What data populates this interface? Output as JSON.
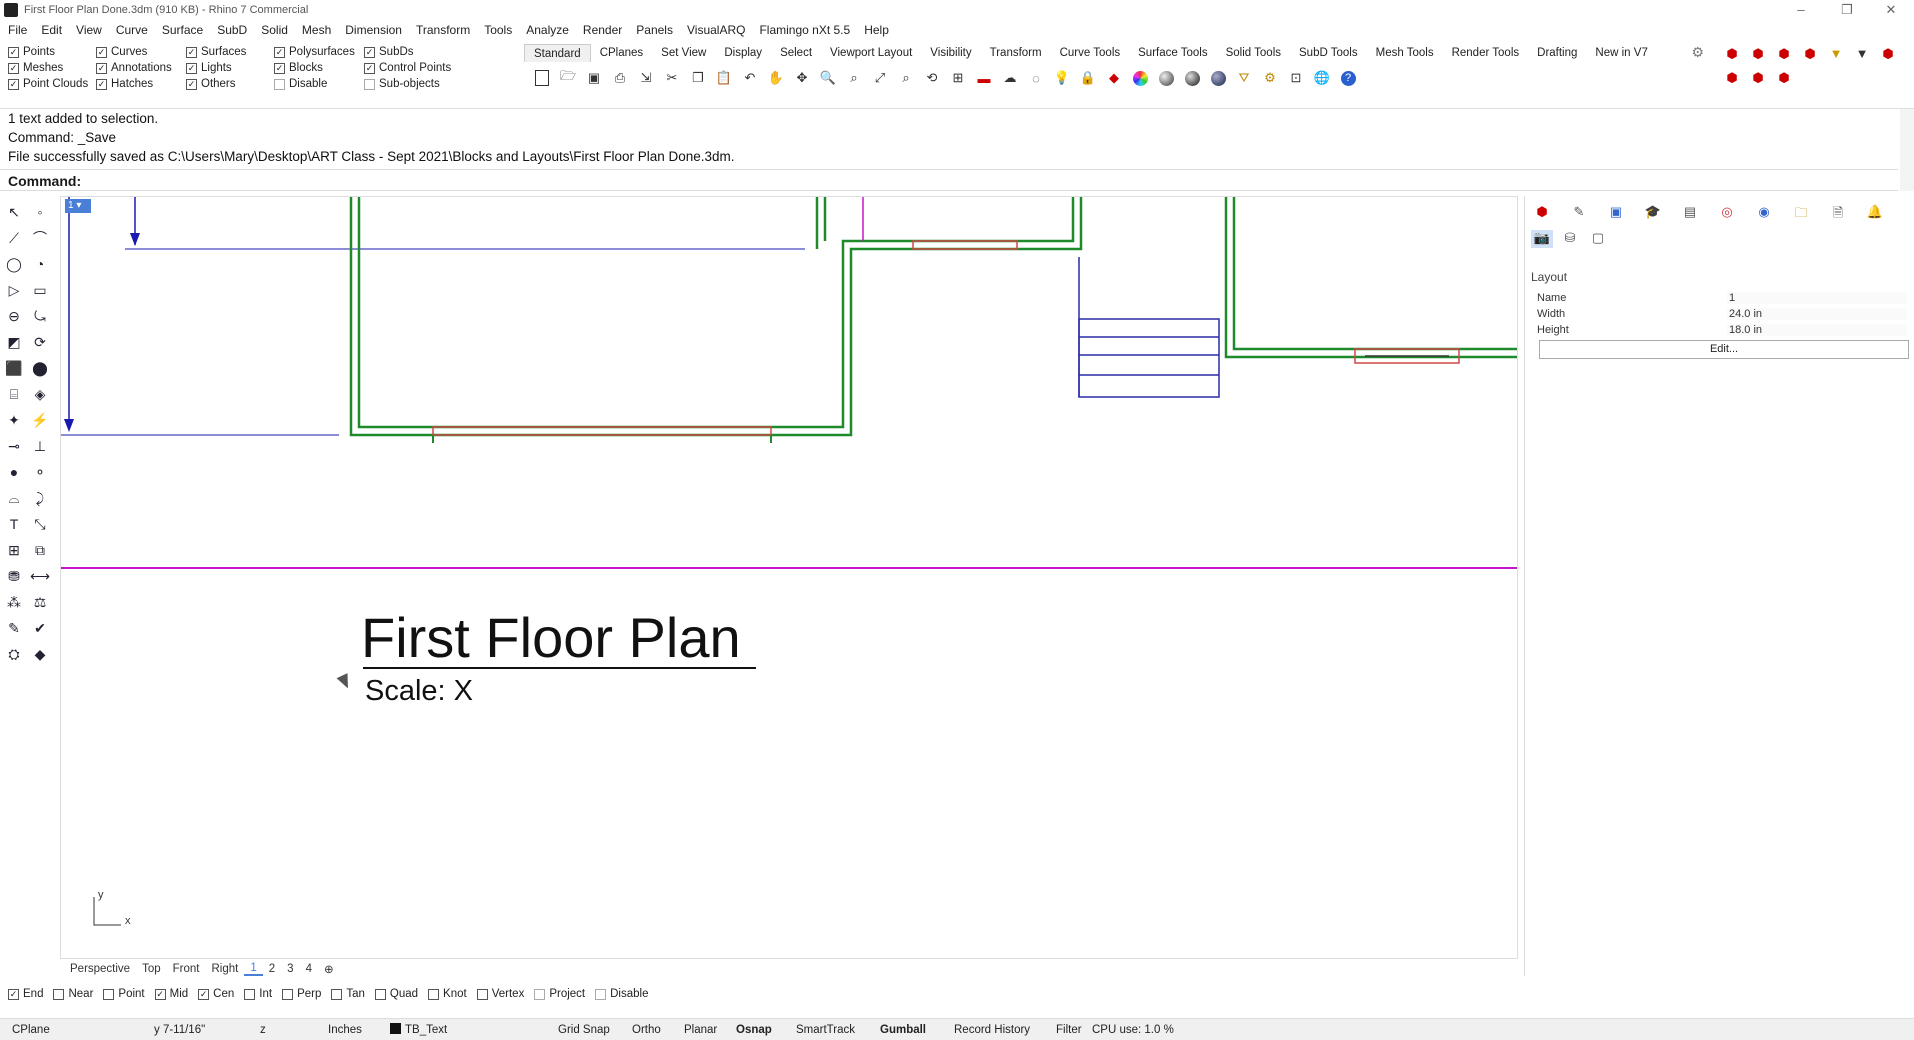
{
  "window": {
    "title": "First Floor Plan Done.3dm (910 KB) - Rhino 7 Commercial",
    "controls": [
      "–",
      "❐",
      "✕"
    ]
  },
  "menu": [
    "File",
    "Edit",
    "View",
    "Curve",
    "Surface",
    "SubD",
    "Solid",
    "Mesh",
    "Dimension",
    "Transform",
    "Tools",
    "Analyze",
    "Render",
    "Panels",
    "VisualARQ",
    "Flamingo nXt 5.5",
    "Help"
  ],
  "filters": {
    "col1": [
      {
        "label": "Points",
        "checked": true
      },
      {
        "label": "Meshes",
        "checked": true
      },
      {
        "label": "Point Clouds",
        "checked": true
      }
    ],
    "col2": [
      {
        "label": "Curves",
        "checked": true
      },
      {
        "label": "Annotations",
        "checked": true
      },
      {
        "label": "Hatches",
        "checked": true
      }
    ],
    "col3": [
      {
        "label": "Surfaces",
        "checked": true
      },
      {
        "label": "Lights",
        "checked": true
      },
      {
        "label": "Others",
        "checked": true
      }
    ],
    "col4": [
      {
        "label": "Polysurfaces",
        "checked": true
      },
      {
        "label": "Blocks",
        "checked": true
      },
      {
        "label": "Disable",
        "checked": false
      }
    ],
    "col5": [
      {
        "label": "SubDs",
        "checked": true
      },
      {
        "label": "Control Points",
        "checked": true
      },
      {
        "label": "Sub-objects",
        "checked": false
      }
    ]
  },
  "toolbar_tabs": [
    "Standard",
    "CPlanes",
    "Set View",
    "Display",
    "Select",
    "Viewport Layout",
    "Visibility",
    "Transform",
    "Curve Tools",
    "Surface Tools",
    "Solid Tools",
    "SubD Tools",
    "Mesh Tools",
    "Render Tools",
    "Drafting",
    "New in V7"
  ],
  "toolbar_icons": [
    "new-icon",
    "open-icon",
    "save-icon",
    "print-icon",
    "import-icon",
    "cut-icon",
    "copy-icon",
    "paste-icon",
    "undo-icon",
    "pan-icon",
    "rotate-view-icon",
    "zoom-dynamic-icon",
    "zoom-window-icon",
    "zoom-extents-icon",
    "zoom-selected-icon",
    "undo-view-icon",
    "four-viewports-icon",
    "cplane-icon",
    "hide-icon",
    "show-icon",
    "lock-icon",
    "layer-icon",
    "color-icon",
    "render-sphere-icon",
    "shaded-sphere-icon",
    "material-sphere-icon",
    "filter-icon",
    "options-icon",
    "dimension-icon",
    "globe-icon",
    "help-icon"
  ],
  "command": {
    "history": [
      "1 text added to selection.",
      "Command: _Save",
      "File successfully saved as C:\\Users\\Mary\\Desktop\\ART Class - Sept 2021\\Blocks and Layouts\\First Floor Plan Done.3dm."
    ],
    "prompt": "Command:"
  },
  "viewport": {
    "label": "1",
    "drawing_title": "First Floor Plan",
    "drawing_scale": "Scale: X",
    "axis_y": "y",
    "axis_x": "x"
  },
  "viewport_tabs": [
    "Perspective",
    "Top",
    "Front",
    "Right",
    "1",
    "2",
    "3",
    "4",
    "⊕"
  ],
  "panel": {
    "section": "Layout",
    "properties": [
      {
        "key": "Name",
        "value": "1"
      },
      {
        "key": "Width",
        "value": "24.0 in"
      },
      {
        "key": "Height",
        "value": "18.0 in"
      }
    ],
    "edit_label": "Edit..."
  },
  "osnap": [
    {
      "label": "End",
      "checked": true
    },
    {
      "label": "Near",
      "checked": false
    },
    {
      "label": "Point",
      "checked": false
    },
    {
      "label": "Mid",
      "checked": true
    },
    {
      "label": "Cen",
      "checked": true
    },
    {
      "label": "Int",
      "checked": false
    },
    {
      "label": "Perp",
      "checked": false
    },
    {
      "label": "Tan",
      "checked": false
    },
    {
      "label": "Quad",
      "checked": false
    },
    {
      "label": "Knot",
      "checked": false
    },
    {
      "label": "Vertex",
      "checked": false
    },
    {
      "label": "Project",
      "checked": false
    },
    {
      "label": "Disable",
      "checked": false
    }
  ],
  "status": {
    "cplane": "CPlane",
    "y": "y 7-11/16\"",
    "z": "z",
    "units": "Inches",
    "layer": "TB_Text",
    "grid_snap": "Grid Snap",
    "ortho": "Ortho",
    "planar": "Planar",
    "osnap": "Osnap",
    "smarttrack": "SmartTrack",
    "gumball": "Gumball",
    "record_history": "Record History",
    "filter": "Filter",
    "cpu": "CPU use: 1.0 %"
  },
  "colors": {
    "walls": "#1f8a2a",
    "windows": "#d04848",
    "stairs": "#2a2aa8",
    "page_line": "#c814c8",
    "dimension": "#1a1ab0",
    "accent": "#4a7fd8"
  }
}
